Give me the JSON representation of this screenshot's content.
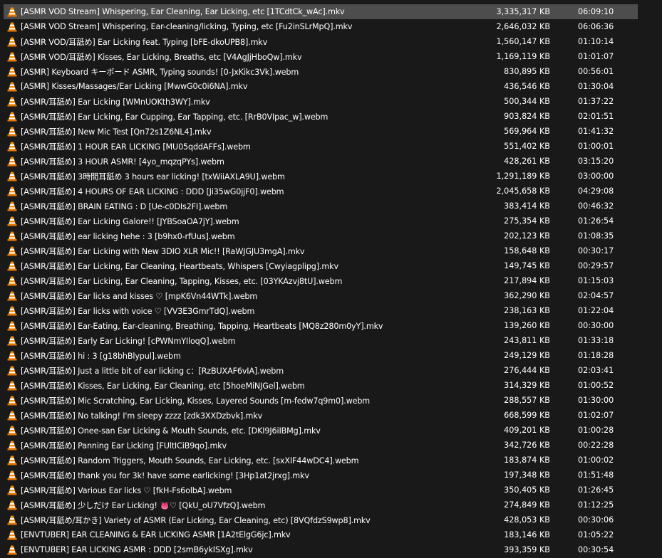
{
  "selected_index": 0,
  "file_icon": "vlc-cone-icon",
  "colors": {
    "background": "#191919",
    "selected": "#4d4d4d",
    "text": "#ffffff",
    "icon_orange": "#f48b00"
  },
  "files": [
    {
      "name": "[ASMR VOD Stream] Whispering, Ear Cleaning, Ear Licking, etc [1TCdtCk_wAc].mkv",
      "size": "3,335,317 KB",
      "length": "06:09:10"
    },
    {
      "name": "[ASMR VOD Stream] Whispering, Ear-cleaning/licking, Typing, etc [Fu2inSLrMpQ].mkv",
      "size": "2,646,032 KB",
      "length": "06:06:36"
    },
    {
      "name": "[ASMR VOD/耳舐め] Ear Licking feat. Typing [bFE-dkoUPB8].mkv",
      "size": "1,560,147 KB",
      "length": "01:10:14"
    },
    {
      "name": "[ASMR VOD/耳舐め] Kisses, Ear Licking, Breaths, etc [V4AgJjHboQw].mkv",
      "size": "1,169,119 KB",
      "length": "01:01:07"
    },
    {
      "name": "[ASMR] Keyboard キーボード ASMR, Typing sounds! [0-JxKikc3Vk].webm",
      "size": "830,895 KB",
      "length": "00:56:01"
    },
    {
      "name": "[ASMR] Kisses/Massages/Ear Licking [MwwG0c0i6NA].mkv",
      "size": "436,546 KB",
      "length": "01:30:04"
    },
    {
      "name": "[ASMR/耳舐め]  Ear Licking [WMnUOKth3WY].mkv",
      "size": "500,344 KB",
      "length": "01:37:22"
    },
    {
      "name": "[ASMR/耳舐め]  Ear Licking, Ear Cupping, Ear Tapping, etc. [RrB0VIpac_w].webm",
      "size": "903,824 KB",
      "length": "02:01:51"
    },
    {
      "name": "[ASMR/耳舐め]  New Mic Test [Qn72s1Z6NL4].mkv",
      "size": "569,964 KB",
      "length": "01:41:32"
    },
    {
      "name": "[ASMR/耳舐め] 1 HOUR EAR LICKING [MU05qddAFFs].webm",
      "size": "551,402 KB",
      "length": "01:00:01"
    },
    {
      "name": "[ASMR/耳舐め] 3 HOUR ASMR! [4yo_mqzqPYs].webm",
      "size": "428,261 KB",
      "length": "03:15:20"
    },
    {
      "name": "[ASMR/耳舐め] 3時間耳舐め 3 hours ear licking! [txWiiAXLA9U].webm",
      "size": "1,291,189 KB",
      "length": "03:00:00"
    },
    {
      "name": "[ASMR/耳舐め] 4 HOURS OF EAR LICKING : DDD [Ji35wG0jjF0].webm",
      "size": "2,045,658 KB",
      "length": "04:29:08"
    },
    {
      "name": "[ASMR/耳舐め] BRAIN EATING : D [Ue-c0DIs2FI].webm",
      "size": "383,414 KB",
      "length": "00:46:32"
    },
    {
      "name": "[ASMR/耳舐め] Ear Licking Galore!! [JYBSoaOA7jY].webm",
      "size": "275,354 KB",
      "length": "01:26:54"
    },
    {
      "name": "[ASMR/耳舐め] ear licking hehe : 3 [b9hx0-rfUus].webm",
      "size": "202,123 KB",
      "length": "01:08:35"
    },
    {
      "name": "[ASMR/耳舐め] Ear Licking with New 3DIO XLR Mic!! [RaWJGJU3mgA].mkv",
      "size": "158,648 KB",
      "length": "00:30:17"
    },
    {
      "name": "[ASMR/耳舐め] Ear Licking, Ear Cleaning, Heartbeats, Whispers [Cwyiagplipg].mkv",
      "size": "149,745 KB",
      "length": "00:29:57"
    },
    {
      "name": "[ASMR/耳舐め] Ear Licking, Ear Cleaning, Tapping, Kisses, etc. [03YKAzvj8tU].webm",
      "size": "217,894 KB",
      "length": "01:15:03"
    },
    {
      "name": "[ASMR/耳舐め] Ear licks and kisses ♡ [mpK6Vn44WTk].webm",
      "size": "362,290 KB",
      "length": "02:04:57"
    },
    {
      "name": "[ASMR/耳舐め] Ear licks with voice ♡ [VV3E3GmrTdQ].webm",
      "size": "238,163 KB",
      "length": "01:22:04"
    },
    {
      "name": "[ASMR/耳舐め] Ear-Eating, Ear-cleaning, Breathing, Tapping, Heartbeats [MQ8z280m0yY].mkv",
      "size": "139,260 KB",
      "length": "00:30:00"
    },
    {
      "name": "[ASMR/耳舐め] Early Ear Licking! [cPWNmYIloqQ].webm",
      "size": "243,811 KB",
      "length": "01:33:18"
    },
    {
      "name": "[ASMR/耳舐め] hi : 3 [g18bhBlypul].webm",
      "size": "249,129 KB",
      "length": "01:18:28"
    },
    {
      "name": "[ASMR/耳舐め] Just a little bit of ear licking c：[RzBUXAF6vIA].webm",
      "size": "276,444 KB",
      "length": "02:03:41"
    },
    {
      "name": "[ASMR/耳舐め] Kisses, Ear Licking, Ear Cleaning, etc [5hoeMiNJGel].webm",
      "size": "314,329 KB",
      "length": "01:00:52"
    },
    {
      "name": "[ASMR/耳舐め] Mic Scratching, Ear Licking, Kisses, Layered Sounds [m-fedw7q9m0].webm",
      "size": "288,557 KB",
      "length": "01:30:00"
    },
    {
      "name": "[ASMR/耳舐め] No talking! I'm sleepy zzzz [zdk3XXDzbvk].mkv",
      "size": "668,599 KB",
      "length": "01:02:07"
    },
    {
      "name": "[ASMR/耳舐め] Onee-san Ear Licking & Mouth Sounds, etc. [DKI9J6iIBMg].mkv",
      "size": "409,201 KB",
      "length": "01:00:28"
    },
    {
      "name": "[ASMR/耳舐め] Panning Ear Licking [FUltICiB9qo].mkv",
      "size": "342,726 KB",
      "length": "00:22:28"
    },
    {
      "name": "[ASMR/耳舐め] Random Triggers, Mouth Sounds, Ear Licking, etc. [sxXIF44wDC4].webm",
      "size": "183,874 KB",
      "length": "01:00:02"
    },
    {
      "name": "[ASMR/耳舐め] thank you for 3k! have some earlicking! [3Hp1at2jrxg].mkv",
      "size": "197,348 KB",
      "length": "01:51:48"
    },
    {
      "name": "[ASMR/耳舐め] Various Ear licks ♡ [fkH-Fs6olbA].webm",
      "size": "350,405 KB",
      "length": "01:26:45"
    },
    {
      "name": "[ASMR/耳舐め] 少しだけ Ear Licking! 👅♡ [QkU_oU7VfzQ].webm",
      "size": "274,849 KB",
      "length": "01:12:25"
    },
    {
      "name": "[ASMR/耳舐め/耳かき] Variety of ASMR (Ear Licking, Ear Cleaning, etc) [8VQfdzS9wp8].mkv",
      "size": "428,053 KB",
      "length": "00:30:06"
    },
    {
      "name": "[ENVTUBER] EAR CLEANING & EAR LICKING ASMR [1A2tElgG6jc].mkv",
      "size": "183,146 KB",
      "length": "01:05:22"
    },
    {
      "name": "[ENVTUBER] EAR LICKING ASMR : DDD [2smB6ykISXg].mkv",
      "size": "393,359 KB",
      "length": "00:30:54"
    }
  ]
}
